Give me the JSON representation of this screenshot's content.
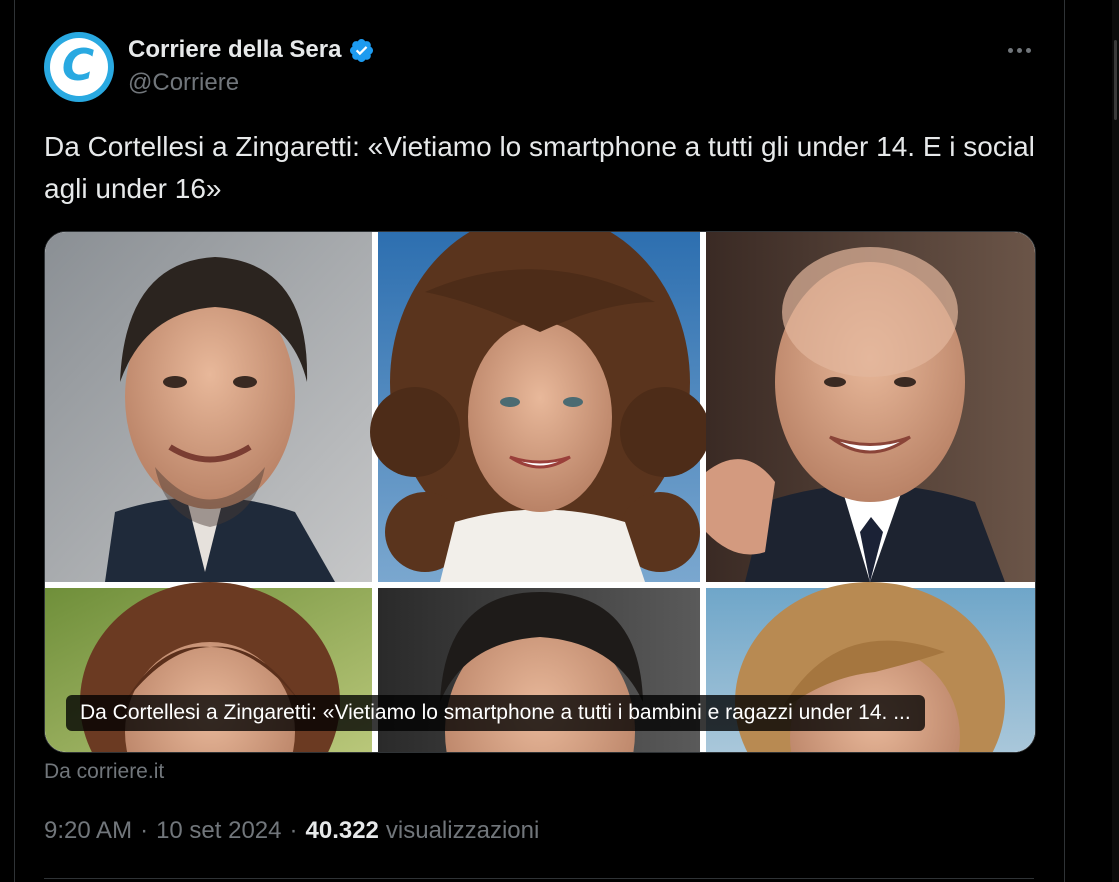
{
  "author": {
    "display_name": "Corriere della Sera",
    "handle": "@Corriere",
    "avatar_letter": "C",
    "verified": true
  },
  "tweet": {
    "text": "Da Cortellesi a Zingaretti: «Vietiamo lo smartphone a tutti gli under 14. E i social agli under 16»"
  },
  "card": {
    "caption": "Da Cortellesi a Zingaretti: «Vietiamo lo smartphone a tutti i bambini e ragazzi under 14. ...",
    "source": "Da corriere.it"
  },
  "meta": {
    "time": "9:20 AM",
    "separator": "·",
    "date": "10 set 2024",
    "views_count": "40.322",
    "views_label": "visualizzazioni"
  },
  "icons": {
    "verified": "verified-badge-icon",
    "more": "more-options-icon",
    "avatar": "corriere-logo"
  },
  "colors": {
    "background": "#000000",
    "text_primary": "#e7e9ea",
    "text_secondary": "#71767b",
    "verified_blue": "#1d9bf0",
    "brand_blue": "#29a9e1",
    "divider": "#2f3336"
  }
}
